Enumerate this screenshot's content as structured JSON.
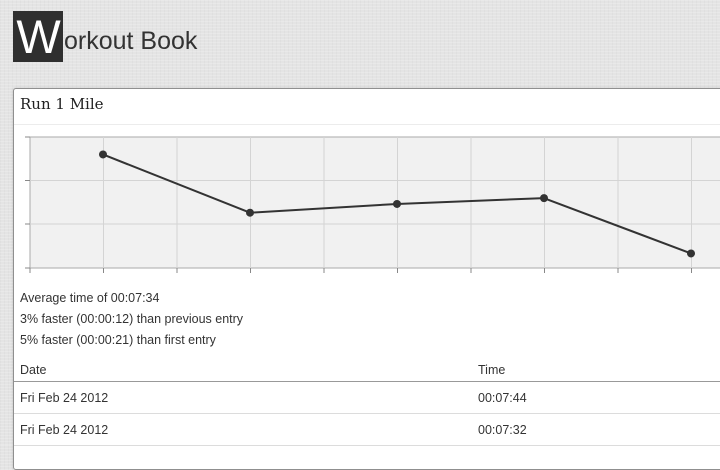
{
  "app": {
    "logo_letter": "W",
    "logo_rest": "orkout Book"
  },
  "exercise": {
    "title": "Run 1 Mile"
  },
  "chart_data": {
    "type": "line",
    "title": "",
    "xlabel": "",
    "ylabel": "",
    "x": [
      1,
      2,
      3,
      4,
      5
    ],
    "series": [
      {
        "values": [
          464,
          444,
          447,
          449,
          430
        ]
      }
    ],
    "grid": true,
    "colors": {
      "line": "#333333",
      "marker": "#333333",
      "plot_background": "#f1f1f1",
      "grid": "#d4d4d4"
    }
  },
  "stats": {
    "average": "Average time of 00:07:34",
    "vs_previous": "3% faster (00:00:12) than previous entry",
    "vs_first": "5% faster (00:00:21) than first entry"
  },
  "table": {
    "headers": {
      "date": "Date",
      "time": "Time"
    },
    "rows": [
      {
        "date": "Fri Feb 24 2012",
        "time": "00:07:44"
      },
      {
        "date": "Fri Feb 24 2012",
        "time": "00:07:32"
      }
    ]
  }
}
